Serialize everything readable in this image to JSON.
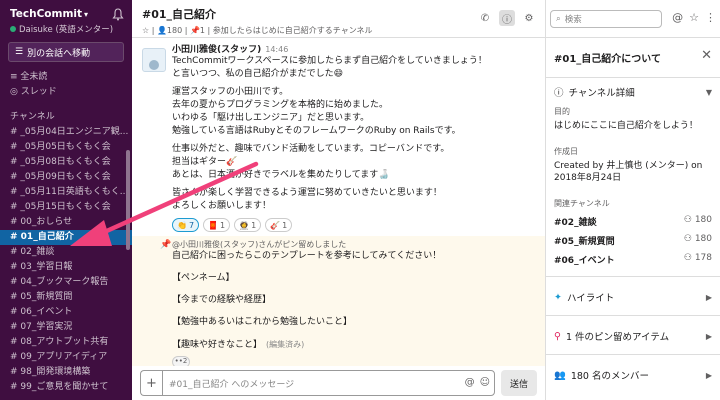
{
  "workspace": {
    "name": "TechCommit",
    "user": "Daisuke (英語メンター)"
  },
  "sidebar": {
    "jump_label": "別の会話へ移動",
    "top_items": [
      {
        "label": "全未読"
      },
      {
        "label": "スレッド"
      }
    ],
    "section_label": "チャンネル",
    "channels": [
      {
        "label": "# _05月04日エンジニア観...",
        "bold": false
      },
      {
        "label": "# _05月05日もくもく会",
        "bold": false
      },
      {
        "label": "# _05月08日もくもく会",
        "bold": false
      },
      {
        "label": "# _05月09日もくもく会",
        "bold": false
      },
      {
        "label": "# _05月11日英語もくもく...",
        "bold": false
      },
      {
        "label": "# _05月15日もくもく会",
        "bold": false
      },
      {
        "label": "# 00_おしらせ",
        "bold": false
      },
      {
        "label": "# 01_自己紹介",
        "bold": true,
        "active": true
      },
      {
        "label": "# 02_雑談",
        "bold": false
      },
      {
        "label": "# 03_学習日報",
        "bold": false
      },
      {
        "label": "# 04_ブックマーク報告",
        "bold": false
      },
      {
        "label": "# 05_新規質問",
        "bold": false
      },
      {
        "label": "# 06_イベント",
        "bold": false
      },
      {
        "label": "# 07_学習実況",
        "bold": false
      },
      {
        "label": "# 08_アウトプット共有",
        "bold": false
      },
      {
        "label": "# 09_アプリアイディア",
        "bold": false
      },
      {
        "label": "# 98_開発環境構築",
        "bold": false
      },
      {
        "label": "# 99_ご意見を聞かせて",
        "bold": false
      }
    ]
  },
  "channel": {
    "title": "#01_自己紹介",
    "meta": "☆ | 👤180 | 📌1 | 参加したらはじめに自己紹介するチャンネル"
  },
  "message": {
    "sender": "小田川雅俊(スタッフ)",
    "time": "14:46",
    "paragraphs": [
      [
        "TechCommitワークスペースに参加したらまず自己紹介をしていきましょう！",
        "と言いつつ、私の自己紹介がまだでした😄"
      ],
      [
        "運営スタッフの小田川です。",
        "去年の夏からプログラミングを本格的に始めました。",
        "いわゆる「駆け出しエンジニア」だと思います。",
        "勉強している言語はRubyとそのフレームワークのRuby on Railsです。"
      ],
      [
        "仕事以外だと、趣味でバンド活動をしています。コピーバンドです。",
        "担当はギター🎸",
        "あとは、日本酒が好きでラベルを集めたりしてます🍶"
      ],
      [
        "皆さんが楽しく学習できるよう運営に努めていきたいと思います！",
        "よろしくお願いします！"
      ]
    ],
    "reactions": [
      {
        "emoji": "👏",
        "count": "7",
        "mine": true
      },
      {
        "emoji": "🧧",
        "count": "1",
        "mine": false
      },
      {
        "emoji": "👩‍🚀",
        "count": "1",
        "mine": false
      },
      {
        "emoji": "🎸",
        "count": "1",
        "mine": false
      }
    ]
  },
  "pinned": {
    "note": "@小田川雅俊(スタッフ)さんがピン留めしました",
    "intro": "自己紹介に困ったらこのテンプレートを参考にしてみてください！",
    "blocks": [
      "【ペンネーム】",
      "【今までの経験や経歴】",
      "【勉強中あるいはこれから勉強したいこと】",
      "【趣味や好きなこと】"
    ],
    "edited": "(編集済み)",
    "more": "••2"
  },
  "composer": {
    "placeholder": "#01_自己紹介 へのメッセージ",
    "send_label": "送信"
  },
  "right": {
    "search_placeholder": "検索",
    "about_title": "#01_自己紹介について",
    "details_label": "チャンネル詳細",
    "purpose_label": "目的",
    "purpose_value": "はじめにここに自己紹介をしよう！",
    "created_label": "作成日",
    "created_value_1": "Created by 井上慎也 (メンター) on",
    "created_value_2": "2018年8月24日",
    "related_label": "関連チャンネル",
    "related": [
      {
        "name": "#02_雑談",
        "count": "180"
      },
      {
        "name": "#05_新規質問",
        "count": "180"
      },
      {
        "name": "#06_イベント",
        "count": "178"
      }
    ],
    "highlight_label": "ハイライト",
    "pins_label": "1 件のピン留めアイテム",
    "members_label": "180 名のメンバー"
  }
}
